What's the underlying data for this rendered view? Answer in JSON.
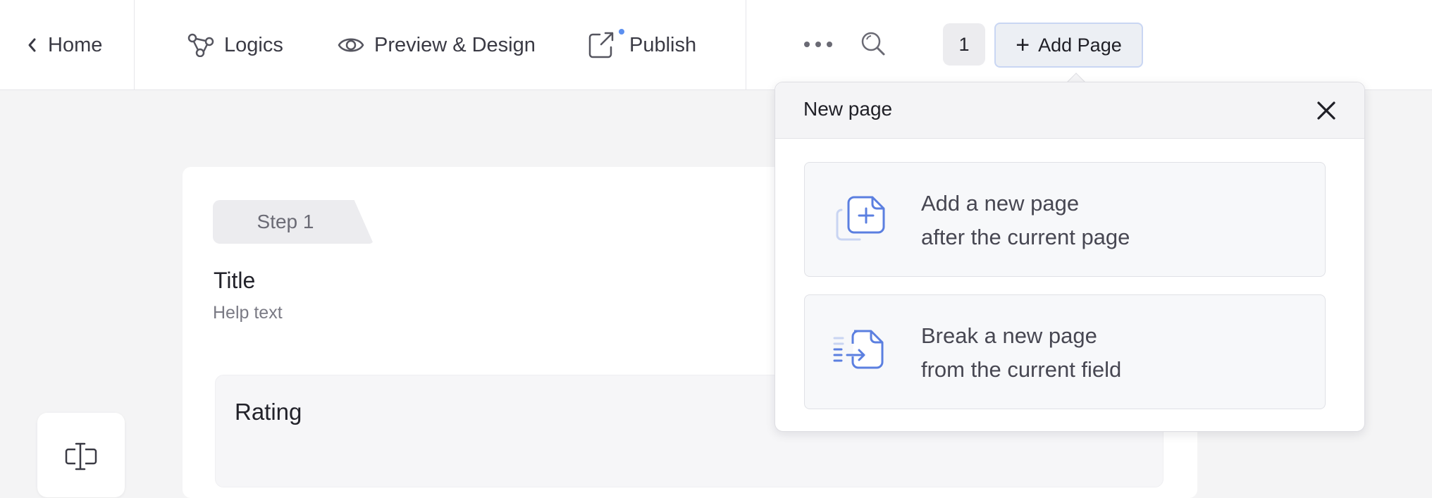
{
  "topbar": {
    "home_label": "Home",
    "logics_label": "Logics",
    "preview_label": "Preview & Design",
    "publish_label": "Publish",
    "page_number": "1",
    "add_page_label": "Add Page"
  },
  "canvas": {
    "step_label": "Step 1",
    "title": "Title",
    "help_text": "Help text",
    "rating_label": "Rating"
  },
  "popover": {
    "title": "New page",
    "options": [
      {
        "line1": "Add a new page",
        "line2": "after the current page",
        "icon": "add-page-icon"
      },
      {
        "line1": "Break a new page",
        "line2": "from the current field",
        "icon": "break-page-icon"
      }
    ]
  },
  "colors": {
    "accent": "#5b7fe0",
    "publish_dot": "#5b8ff0"
  }
}
